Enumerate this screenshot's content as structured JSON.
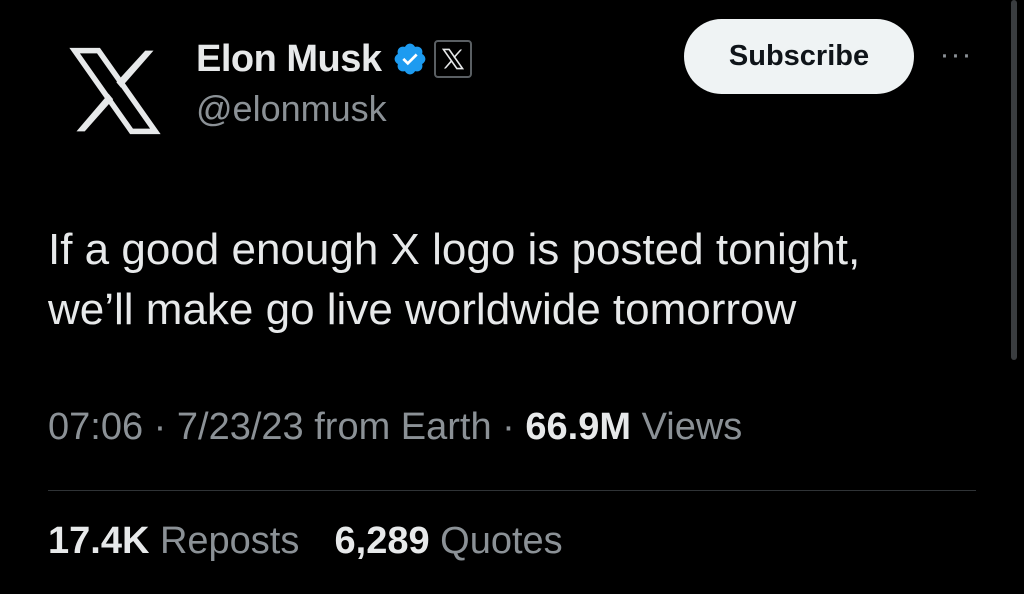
{
  "author": {
    "name": "Elon Musk",
    "handle": "@elonmusk",
    "verified_color": "#1d9bf0",
    "avatar_icon": "x-logo-icon",
    "affiliation_icon": "x-logo-icon"
  },
  "actions": {
    "subscribe_label": "Subscribe",
    "more_icon": "more-horizontal-icon",
    "more_glyph": "···"
  },
  "tweet": {
    "lines": [
      "If a good enough X logo is posted tonight,",
      "we’ll make go live worldwide tomorrow"
    ]
  },
  "meta": {
    "time": "07:06",
    "sep1": " · ",
    "date": "7/23/23",
    "source": " from Earth",
    "sep2": " · ",
    "views_count": "66.9M",
    "views_label": " Views"
  },
  "stats": {
    "reposts_count": "17.4K",
    "reposts_label": " Reposts",
    "quotes_count": "6,289",
    "quotes_label": " Quotes"
  }
}
